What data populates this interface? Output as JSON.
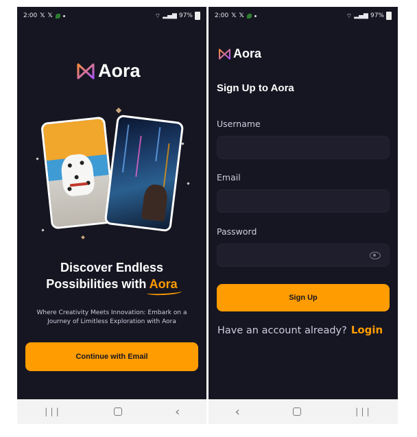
{
  "status_bar": {
    "time": "2:00",
    "battery": "97%"
  },
  "colors": {
    "background": "#161622",
    "accent": "#ff9c01",
    "field": "#1e1e2d"
  },
  "welcome": {
    "app_name": "Aora",
    "headline_line1": "Discover Endless",
    "headline_line2": "Possibilities with",
    "headline_accent": "Aora",
    "subtext": "Where Creativity Meets Innovation: Embark on a Journey of Limitless Exploration with Aora",
    "cta_label": "Continue with Email"
  },
  "signup": {
    "app_name": "Aora",
    "title": "Sign Up to Aora",
    "fields": [
      {
        "label": "Username",
        "value": ""
      },
      {
        "label": "Email",
        "value": ""
      },
      {
        "label": "Password",
        "value": ""
      }
    ],
    "submit_label": "Sign Up",
    "login_prompt": "Have an account already?",
    "login_link": "Login"
  },
  "icons": {
    "logo": "aora-logo-icon",
    "password_toggle": "eye-icon",
    "nav": [
      "back-icon",
      "home-icon",
      "recent-apps-icon"
    ]
  }
}
